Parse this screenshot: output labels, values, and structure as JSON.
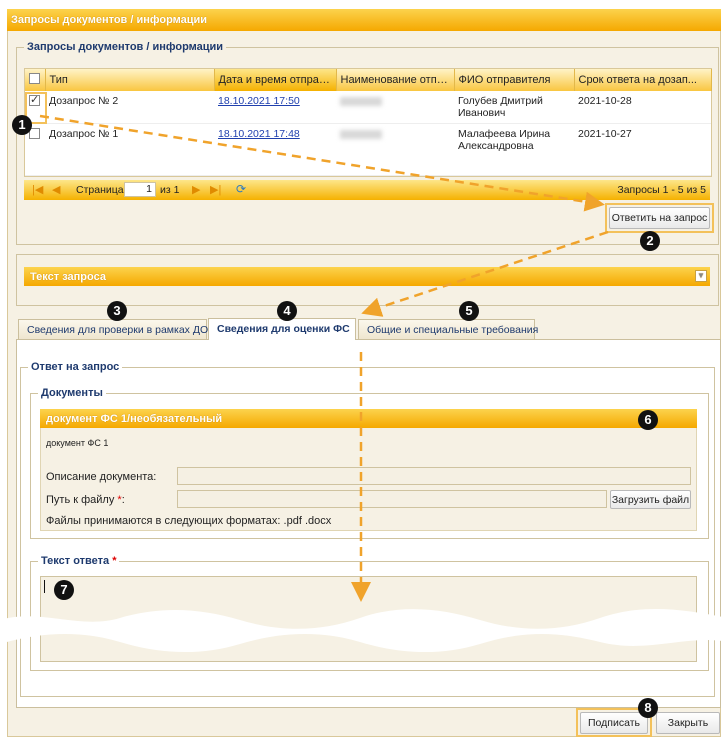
{
  "window": {
    "title": "Запросы документов / информации"
  },
  "requests_section": {
    "legend": "Запросы документов / информации",
    "columns": [
      "Тип",
      "Дата и время отправк...",
      "Наименование отпра...",
      "ФИО отправителя",
      "Срок ответа на дозап..."
    ],
    "rows": [
      {
        "type": "Дозапрос № 2",
        "datetime": "18.10.2021 17:50",
        "fio_line1": "Голубев Дмитрий",
        "fio_line2": "Иванович",
        "deadline": "2021-10-28",
        "checked": true
      },
      {
        "type": "Дозапрос № 1",
        "datetime": "18.10.2021 17:48",
        "fio_line1": "Малафеева Ирина",
        "fio_line2": "Александровна",
        "deadline": "2021-10-27",
        "checked": false
      }
    ],
    "pager": {
      "page_label": "Страница",
      "page_value": "1",
      "of_label": "из 1",
      "summary": "Запросы 1 - 5 из 5"
    },
    "reply_button": "Ответить на запрос"
  },
  "request_text_panel": {
    "title": "Текст запроса"
  },
  "tabs": [
    "Сведения для проверки в рамках ДО",
    "Сведения для оценки ФС",
    "Общие и специальные требования"
  ],
  "answer": {
    "legend": "Ответ на запрос",
    "documents_legend": "Документы",
    "doc_panel_title": "документ ФС 1/необязательный",
    "doc_name": "документ ФС 1",
    "description_label": "Описание документа:",
    "path_label": "Путь к файлу",
    "required_mark": "*",
    "path_colon": ":",
    "upload_button": "Загрузить файл",
    "formats_note": "Файлы принимаются в следующих форматах: .pdf .docx",
    "reply_text_legend": "Текст ответа"
  },
  "footer": {
    "sign_button": "Подписать",
    "close_button": "Закрыть"
  },
  "badges": [
    "1",
    "2",
    "3",
    "4",
    "5",
    "6",
    "7",
    "8"
  ],
  "colors": {
    "accent": "#f5a800",
    "highlight": "#f3c15a",
    "link": "#1f3fae"
  }
}
